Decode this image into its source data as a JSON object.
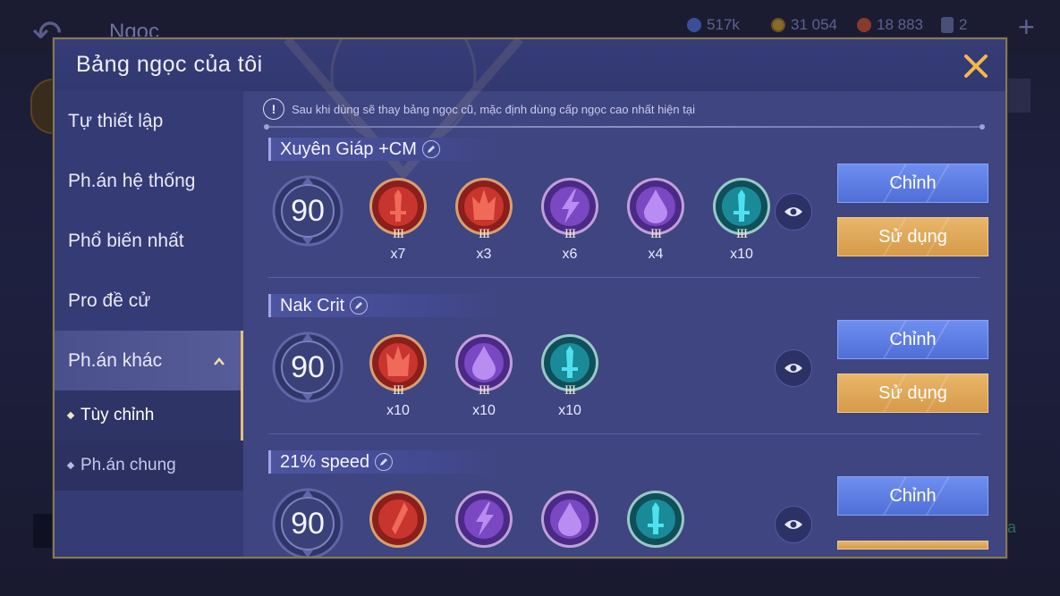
{
  "background": {
    "screen_title": "Ngọc",
    "currencies": [
      {
        "icon": "diamond-currency-icon",
        "value": "517k"
      },
      {
        "icon": "gold-coin-icon",
        "value": "31 054"
      },
      {
        "icon": "red-gem-currency-icon",
        "value": "18 883"
      },
      {
        "icon": "card-icon",
        "value": "2"
      }
    ],
    "plus_label": "+",
    "side_text": "a"
  },
  "dialog": {
    "title": "Bảng ngọc của tôi",
    "notice": "Sau khi dùng sẽ thay bảng ngọc cũ, mặc định dùng cấp ngọc cao nhất hiện tại",
    "notice_icon": "!"
  },
  "sidebar": {
    "items": [
      {
        "label": "Tự thiết lập"
      },
      {
        "label": "Ph.án hệ thống"
      },
      {
        "label": "Phổ biến nhất"
      },
      {
        "label": "Pro đề cử"
      },
      {
        "label": "Ph.án khác"
      }
    ],
    "sub_items": [
      {
        "label": "Tùy chỉnh"
      },
      {
        "label": "Ph.án chung"
      }
    ]
  },
  "sets": [
    {
      "name": "Xuyên Giáp +CM",
      "level": "90",
      "gems": [
        {
          "color": "red",
          "icon": "sword-gem-icon",
          "tier": "III",
          "count": "x7"
        },
        {
          "color": "red",
          "icon": "crown-gem-icon",
          "tier": "III",
          "count": "x3"
        },
        {
          "color": "purple",
          "icon": "lightning-gem-icon",
          "tier": "III",
          "count": "x6"
        },
        {
          "color": "purple",
          "icon": "drop-gem-icon",
          "tier": "III",
          "count": "x4"
        },
        {
          "color": "teal",
          "icon": "sword-gem-icon",
          "tier": "III",
          "count": "x10"
        }
      ],
      "edit_label": "Chỉnh",
      "use_label": "Sử dụng"
    },
    {
      "name": "Nak Crit",
      "level": "90",
      "gems": [
        {
          "color": "red",
          "icon": "crown-gem-icon",
          "tier": "III",
          "count": "x10"
        },
        {
          "color": "purple",
          "icon": "drop-gem-icon",
          "tier": "III",
          "count": "x10"
        },
        {
          "color": "teal",
          "icon": "sword-gem-icon",
          "tier": "III",
          "count": "x10"
        }
      ],
      "edit_label": "Chỉnh",
      "use_label": "Sử dụng"
    },
    {
      "name": "21% speed",
      "level": "90",
      "gems": [
        {
          "color": "red",
          "icon": "blade-gem-icon",
          "tier": "",
          "count": ""
        },
        {
          "color": "purple",
          "icon": "lightning-gem-icon",
          "tier": "",
          "count": ""
        },
        {
          "color": "purple",
          "icon": "drop-gem-icon",
          "tier": "",
          "count": ""
        },
        {
          "color": "teal",
          "icon": "sword-gem-icon",
          "tier": "",
          "count": ""
        }
      ],
      "edit_label": "Chỉnh",
      "use_label": ""
    }
  ],
  "colors": {
    "gem_red": "#c0302c",
    "gem_purple": "#7a44c0",
    "gem_teal": "#1a8a98",
    "button_blue": "#5b7ce0",
    "button_gold": "#e0a858",
    "dialog_bg": "#3f4580"
  }
}
